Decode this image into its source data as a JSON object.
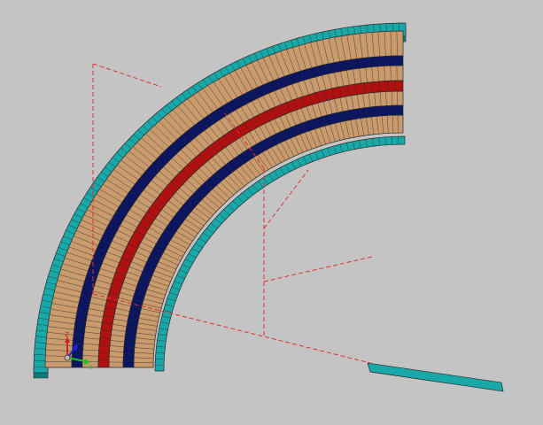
{
  "viewport": {
    "background": "#c4c4c4"
  },
  "model": {
    "type": "curved-coil-winding-section",
    "layers": [
      {
        "name": "outer-shell",
        "color": "#19a8a8"
      },
      {
        "name": "outer-winding",
        "color": "#c89a6c"
      },
      {
        "name": "insulation-1",
        "color": "#0b1560"
      },
      {
        "name": "winding-2",
        "color": "#c89a6c"
      },
      {
        "name": "insulation-2",
        "color": "#b01010"
      },
      {
        "name": "winding-3",
        "color": "#c89a6c"
      },
      {
        "name": "insulation-3",
        "color": "#0b1560"
      },
      {
        "name": "inner-winding",
        "color": "#c89a6c"
      },
      {
        "name": "inner-shell",
        "color": "#19a8a8"
      }
    ],
    "construction_lines_color": "#e03030"
  },
  "triad": {
    "x_label": "X",
    "y_label": "Y",
    "z_label": "Z",
    "x_color": "#20c020",
    "y_color": "#2020d0",
    "z_color": "#d02020"
  }
}
